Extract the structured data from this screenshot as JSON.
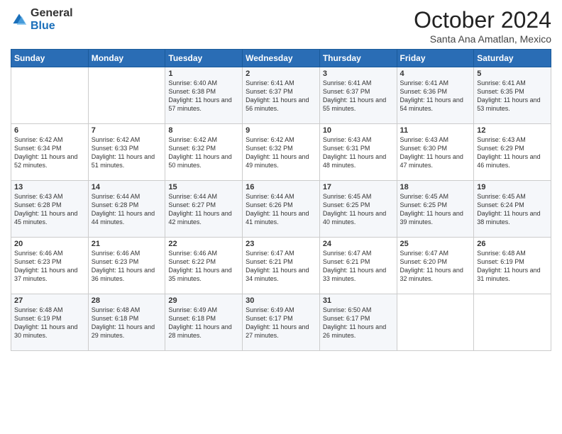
{
  "logo": {
    "general": "General",
    "blue": "Blue"
  },
  "header": {
    "title": "October 2024",
    "subtitle": "Santa Ana Amatlan, Mexico"
  },
  "weekdays": [
    "Sunday",
    "Monday",
    "Tuesday",
    "Wednesday",
    "Thursday",
    "Friday",
    "Saturday"
  ],
  "weeks": [
    [
      null,
      null,
      {
        "day": 1,
        "sunrise": "6:40 AM",
        "sunset": "6:38 PM",
        "daylight": "11 hours and 57 minutes."
      },
      {
        "day": 2,
        "sunrise": "6:41 AM",
        "sunset": "6:37 PM",
        "daylight": "11 hours and 56 minutes."
      },
      {
        "day": 3,
        "sunrise": "6:41 AM",
        "sunset": "6:37 PM",
        "daylight": "11 hours and 55 minutes."
      },
      {
        "day": 4,
        "sunrise": "6:41 AM",
        "sunset": "6:36 PM",
        "daylight": "11 hours and 54 minutes."
      },
      {
        "day": 5,
        "sunrise": "6:41 AM",
        "sunset": "6:35 PM",
        "daylight": "11 hours and 53 minutes."
      }
    ],
    [
      {
        "day": 6,
        "sunrise": "6:42 AM",
        "sunset": "6:34 PM",
        "daylight": "11 hours and 52 minutes."
      },
      {
        "day": 7,
        "sunrise": "6:42 AM",
        "sunset": "6:33 PM",
        "daylight": "11 hours and 51 minutes."
      },
      {
        "day": 8,
        "sunrise": "6:42 AM",
        "sunset": "6:32 PM",
        "daylight": "11 hours and 50 minutes."
      },
      {
        "day": 9,
        "sunrise": "6:42 AM",
        "sunset": "6:32 PM",
        "daylight": "11 hours and 49 minutes."
      },
      {
        "day": 10,
        "sunrise": "6:43 AM",
        "sunset": "6:31 PM",
        "daylight": "11 hours and 48 minutes."
      },
      {
        "day": 11,
        "sunrise": "6:43 AM",
        "sunset": "6:30 PM",
        "daylight": "11 hours and 47 minutes."
      },
      {
        "day": 12,
        "sunrise": "6:43 AM",
        "sunset": "6:29 PM",
        "daylight": "11 hours and 46 minutes."
      }
    ],
    [
      {
        "day": 13,
        "sunrise": "6:43 AM",
        "sunset": "6:28 PM",
        "daylight": "11 hours and 45 minutes."
      },
      {
        "day": 14,
        "sunrise": "6:44 AM",
        "sunset": "6:28 PM",
        "daylight": "11 hours and 44 minutes."
      },
      {
        "day": 15,
        "sunrise": "6:44 AM",
        "sunset": "6:27 PM",
        "daylight": "11 hours and 42 minutes."
      },
      {
        "day": 16,
        "sunrise": "6:44 AM",
        "sunset": "6:26 PM",
        "daylight": "11 hours and 41 minutes."
      },
      {
        "day": 17,
        "sunrise": "6:45 AM",
        "sunset": "6:25 PM",
        "daylight": "11 hours and 40 minutes."
      },
      {
        "day": 18,
        "sunrise": "6:45 AM",
        "sunset": "6:25 PM",
        "daylight": "11 hours and 39 minutes."
      },
      {
        "day": 19,
        "sunrise": "6:45 AM",
        "sunset": "6:24 PM",
        "daylight": "11 hours and 38 minutes."
      }
    ],
    [
      {
        "day": 20,
        "sunrise": "6:46 AM",
        "sunset": "6:23 PM",
        "daylight": "11 hours and 37 minutes."
      },
      {
        "day": 21,
        "sunrise": "6:46 AM",
        "sunset": "6:23 PM",
        "daylight": "11 hours and 36 minutes."
      },
      {
        "day": 22,
        "sunrise": "6:46 AM",
        "sunset": "6:22 PM",
        "daylight": "11 hours and 35 minutes."
      },
      {
        "day": 23,
        "sunrise": "6:47 AM",
        "sunset": "6:21 PM",
        "daylight": "11 hours and 34 minutes."
      },
      {
        "day": 24,
        "sunrise": "6:47 AM",
        "sunset": "6:21 PM",
        "daylight": "11 hours and 33 minutes."
      },
      {
        "day": 25,
        "sunrise": "6:47 AM",
        "sunset": "6:20 PM",
        "daylight": "11 hours and 32 minutes."
      },
      {
        "day": 26,
        "sunrise": "6:48 AM",
        "sunset": "6:19 PM",
        "daylight": "11 hours and 31 minutes."
      }
    ],
    [
      {
        "day": 27,
        "sunrise": "6:48 AM",
        "sunset": "6:19 PM",
        "daylight": "11 hours and 30 minutes."
      },
      {
        "day": 28,
        "sunrise": "6:48 AM",
        "sunset": "6:18 PM",
        "daylight": "11 hours and 29 minutes."
      },
      {
        "day": 29,
        "sunrise": "6:49 AM",
        "sunset": "6:18 PM",
        "daylight": "11 hours and 28 minutes."
      },
      {
        "day": 30,
        "sunrise": "6:49 AM",
        "sunset": "6:17 PM",
        "daylight": "11 hours and 27 minutes."
      },
      {
        "day": 31,
        "sunrise": "6:50 AM",
        "sunset": "6:17 PM",
        "daylight": "11 hours and 26 minutes."
      },
      null,
      null
    ]
  ]
}
